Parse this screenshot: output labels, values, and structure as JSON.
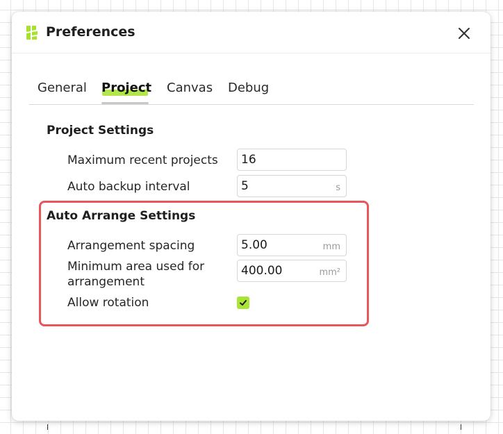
{
  "dialog": {
    "title": "Preferences",
    "close_label": "Close"
  },
  "tabs": [
    {
      "label": "General",
      "active": false
    },
    {
      "label": "Project",
      "active": true
    },
    {
      "label": "Canvas",
      "active": false
    },
    {
      "label": "Debug",
      "active": false
    }
  ],
  "project_settings": {
    "title": "Project Settings",
    "max_recent_label": "Maximum recent projects",
    "max_recent_value": "16",
    "backup_label": "Auto backup interval",
    "backup_value": "5",
    "backup_unit": "s"
  },
  "auto_arrange": {
    "title": "Auto Arrange Settings",
    "spacing_label": "Arrangement spacing",
    "spacing_value": "5.00",
    "spacing_unit": "mm",
    "min_area_label": "Minimum area used for arrangement",
    "min_area_value": "400.00",
    "min_area_unit": "mm²",
    "rotation_label": "Allow rotation",
    "rotation_checked": true
  },
  "colors": {
    "accent": "#a6e22e",
    "highlight_border": "#e8565a"
  },
  "icons": {
    "logo": "app-logo-icon",
    "close": "close-icon",
    "check": "checkmark-icon"
  }
}
